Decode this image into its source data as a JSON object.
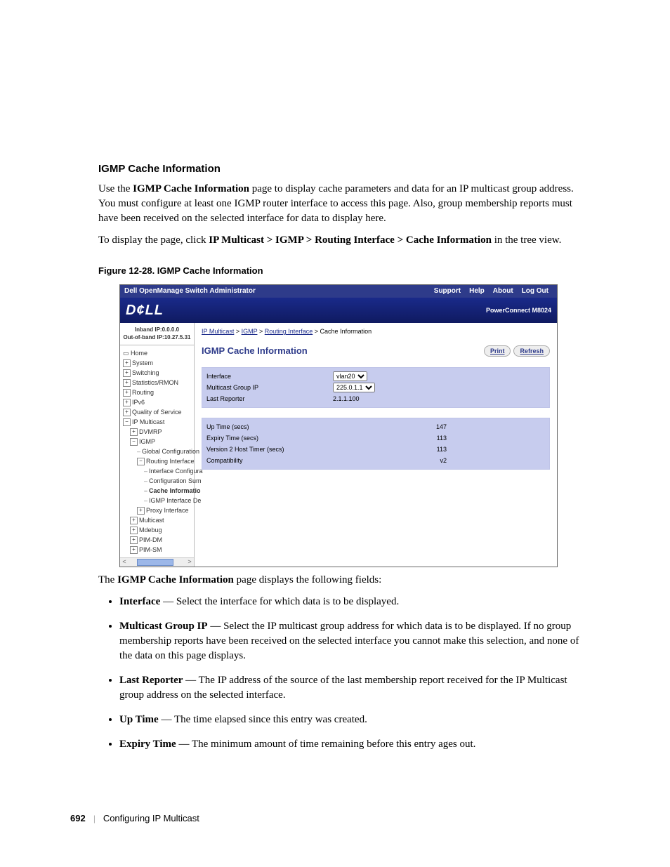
{
  "heading": "IGMP Cache Information",
  "para1_a": "Use the ",
  "para1_b": "IGMP Cache Information",
  "para1_c": " page to display cache parameters and data for an IP multicast group address. You must configure at least one IGMP router interface to access this page. Also, group membership reports must have been received on the selected interface for data to display here.",
  "para2_a": "To display the page, click ",
  "para2_b": "IP Multicast > IGMP > Routing Interface > Cache Information",
  "para2_c": " in the tree view.",
  "figure_caption": "Figure 12-28.    IGMP Cache Information",
  "screenshot": {
    "title": "Dell OpenManage Switch Administrator",
    "nav": {
      "support": "Support",
      "help": "Help",
      "about": "About",
      "logout": "Log Out"
    },
    "logo": "D¢LL",
    "model": "PowerConnect M8024",
    "ip1": "Inband IP:0.0.0.0",
    "ip2": "Out-of-band IP:10.27.5.31",
    "tree": {
      "home": "Home",
      "system": "System",
      "switching": "Switching",
      "stats": "Statistics/RMON",
      "routing": "Routing",
      "ipv6": "IPv6",
      "qos": "Quality of Service",
      "ipmc": "IP Multicast",
      "dvmrp": "DVMRP",
      "igmp": "IGMP",
      "globalcfg": "Global Configuration",
      "ri": "Routing Interface",
      "ifcfg": "Interface Configura",
      "cfgsum": "Configuration Sum",
      "cacheinfo": "Cache Informatio",
      "igmpifdet": "IGMP Interface De",
      "proxy": "Proxy Interface",
      "multicast": "Multicast",
      "mdebug": "Mdebug",
      "pimdm": "PIM-DM",
      "pimsm": "PIM-SM"
    },
    "breadcrumb": {
      "a": "IP Multicast",
      "b": "IGMP",
      "c": "Routing Interface",
      "d": "Cache Information"
    },
    "page_title": "IGMP Cache Information",
    "buttons": {
      "print": "Print",
      "refresh": "Refresh"
    },
    "panel1": {
      "interface_l": "Interface",
      "interface_v": "vlan20",
      "mgip_l": "Multicast Group IP",
      "mgip_v": "225.0.1.1",
      "lr_l": "Last Reporter",
      "lr_v": "2.1.1.100"
    },
    "panel2": {
      "uptime_l": "Up Time (secs)",
      "uptime_v": "147",
      "expiry_l": "Expiry Time (secs)",
      "expiry_v": "113",
      "v2_l": "Version 2 Host Timer (secs)",
      "v2_v": "113",
      "compat_l": "Compatibility",
      "compat_v": "v2"
    }
  },
  "intro2_a": "The ",
  "intro2_b": "IGMP Cache Information",
  "intro2_c": " page displays the following fields:",
  "fields": {
    "interface_t": "Interface",
    "interface_d": " — Select the interface for which data is to be displayed.",
    "mgip_t": "Multicast Group IP",
    "mgip_d": " — Select the IP multicast group address for which data is to be displayed. If no group membership reports have been received on the selected interface you cannot make this selection, and none of the data on this page displays.",
    "lr_t": "Last Reporter",
    "lr_d": " — The IP address of the source of the last membership report received for the IP Multicast group address on the selected interface.",
    "up_t": "Up Time",
    "up_d": " — The time elapsed since this entry was created.",
    "ex_t": "Expiry Time",
    "ex_d": " — The minimum amount of time remaining before this entry ages out."
  },
  "footer": {
    "page": "692",
    "chapter": "Configuring IP Multicast"
  }
}
